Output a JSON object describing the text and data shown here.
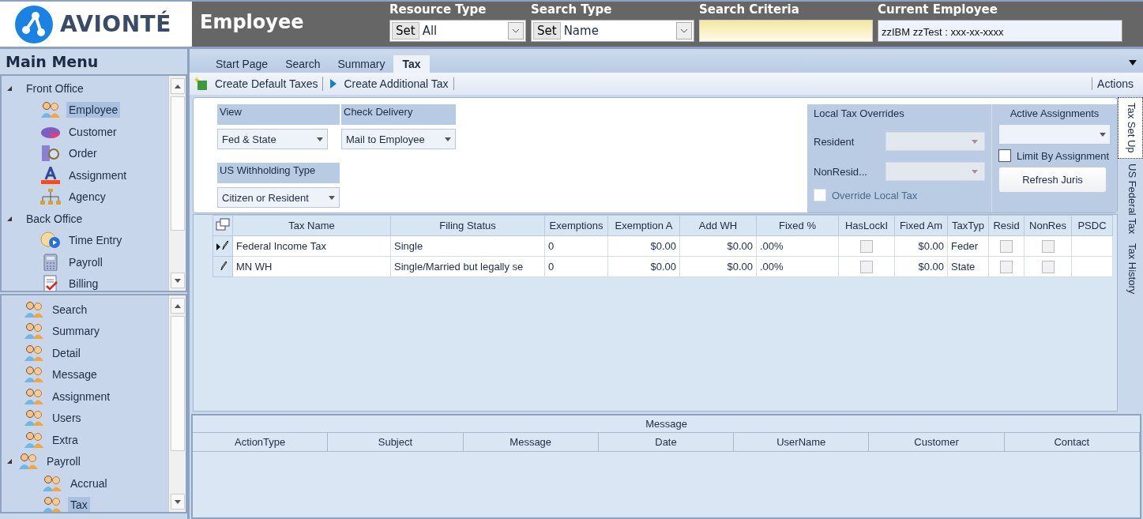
{
  "header": {
    "logo": "AVIONTÉ",
    "title": "Employee",
    "filters": [
      {
        "kind": "select",
        "label": "Resource Type",
        "button": "Set",
        "value": "All"
      },
      {
        "kind": "select",
        "label": "Search Type",
        "button": "Set",
        "value": "Name"
      },
      {
        "kind": "input",
        "label": "Search Criteria"
      },
      {
        "kind": "display",
        "label": "Current Employee",
        "value": "zzIBM  zzTest : xxx-xx-xxxx"
      }
    ]
  },
  "main_menu": {
    "title": "Main Menu",
    "items": [
      {
        "label": "Front Office",
        "expanded": true,
        "children": [
          {
            "label": "Employee",
            "selected": true
          },
          {
            "label": "Customer",
            "selected": false
          },
          {
            "label": "Order",
            "selected": false
          },
          {
            "label": "Assignment",
            "selected": false
          },
          {
            "label": "Agency",
            "selected": false
          }
        ]
      },
      {
        "label": "Back Office",
        "expanded": true,
        "children": [
          {
            "label": "Time Entry",
            "selected": false
          },
          {
            "label": "Payroll",
            "selected": false
          },
          {
            "label": "Billing",
            "selected": false
          }
        ]
      }
    ]
  },
  "sub_menu": {
    "items": [
      {
        "label": "Search",
        "selected": false
      },
      {
        "label": "Summary",
        "selected": false
      },
      {
        "label": "Detail",
        "selected": false
      },
      {
        "label": "Message",
        "selected": false
      },
      {
        "label": "Assignment",
        "selected": false
      },
      {
        "label": "Users",
        "selected": false
      },
      {
        "label": "Extra",
        "selected": false
      },
      {
        "label": "Payroll",
        "selected": false,
        "expanded": true,
        "children": [
          {
            "label": "Accrual",
            "selected": false
          },
          {
            "label": "Tax",
            "selected": true
          }
        ]
      }
    ]
  },
  "tabs": [
    {
      "label": "Start Page",
      "selected": false
    },
    {
      "label": "Search",
      "selected": false
    },
    {
      "label": "Summary",
      "selected": false
    },
    {
      "label": "Tax",
      "selected": true
    }
  ],
  "toolbar": {
    "buttons": [
      {
        "label": "Create Default Taxes"
      },
      {
        "label": "Create Additional Tax"
      }
    ],
    "actions": "Actions"
  },
  "form": {
    "fields": [
      {
        "label": "View",
        "value": "Fed & State"
      },
      {
        "label": "Check Delivery",
        "value": "Mail to Employee"
      },
      {
        "label": "US Withholding Type",
        "value": "Citizen or Resident"
      }
    ],
    "local_overrides": {
      "title": "Local Tax Overrides",
      "resident_label": "Resident",
      "nonresident_label": "NonResid...",
      "override": {
        "label": "Override Local Tax",
        "checked": false,
        "disabled": true
      }
    },
    "assignments": {
      "title": "Active Assignments",
      "limit": {
        "label": "Limit By Assignment",
        "checked": false
      },
      "refresh": "Refresh Juris"
    }
  },
  "tax_table": {
    "columns": [
      {
        "label": "Tax Name",
        "kind": "text"
      },
      {
        "label": "Filing Status",
        "kind": "text"
      },
      {
        "label": "Exemptions",
        "kind": "text"
      },
      {
        "label": "Exemption A",
        "kind": "money"
      },
      {
        "label": "Add WH",
        "kind": "money"
      },
      {
        "label": "Fixed %",
        "kind": "text"
      },
      {
        "label": "HasLockI",
        "kind": "check"
      },
      {
        "label": "Fixed Am",
        "kind": "money"
      },
      {
        "label": "TaxTyp",
        "kind": "text"
      },
      {
        "label": "Resid",
        "kind": "check"
      },
      {
        "label": "NonRes",
        "kind": "check"
      },
      {
        "label": "PSDC"
      }
    ],
    "rows": [
      {
        "current": true,
        "cells": [
          {
            "text": "Federal Income Tax"
          },
          {
            "text": "Single"
          },
          {
            "text": "0"
          },
          {
            "text": "$0.00"
          },
          {
            "text": "$0.00"
          },
          {
            "text": ".00%"
          },
          {
            "checked": false
          },
          {
            "text": "$0.00"
          },
          {
            "text": "Feder"
          },
          {
            "checked": false
          },
          {
            "checked": false
          }
        ]
      },
      {
        "current": false,
        "cells": [
          {
            "text": "MN WH"
          },
          {
            "text": "Single/Married but legally se"
          },
          {
            "text": "0"
          },
          {
            "text": "$0.00"
          },
          {
            "text": "$0.00"
          },
          {
            "text": ".00%"
          },
          {
            "checked": false
          },
          {
            "text": "$0.00"
          },
          {
            "text": "State"
          },
          {
            "checked": false
          },
          {
            "checked": false
          }
        ]
      }
    ]
  },
  "side_tabs": [
    {
      "label": "Tax Set Up",
      "selected": true
    },
    {
      "label": "US Federal Tax",
      "selected": false
    },
    {
      "label": "Tax History",
      "selected": false
    }
  ],
  "message_grid": {
    "title": "Message",
    "columns": [
      "ActionType",
      "Subject",
      "Message",
      "Date",
      "UserName",
      "Customer",
      "Contact"
    ]
  }
}
